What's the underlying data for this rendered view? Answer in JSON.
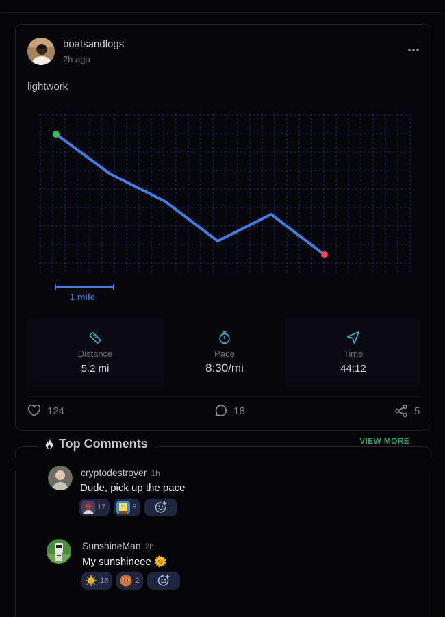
{
  "post": {
    "username": "boatsandlogs",
    "time_ago": "2h ago",
    "caption": "lightwork",
    "scale_label": "1 mile",
    "stats": {
      "distance_label": "Distance",
      "distance_value": "5.2 mi",
      "pace_label": "Pace",
      "pace_value": "8:30/mi",
      "time_label": "Time",
      "time_value": "44:12"
    },
    "likes": "124",
    "comments": "18",
    "shares": "5"
  },
  "top_comments": {
    "title": "Top Comments",
    "view_more": "VIEW MORE",
    "items": [
      {
        "username": "cryptodestroyer",
        "time": "1h",
        "text": "Dude, pick up the pace",
        "reactions": [
          {
            "icon": "person-emoji-icon",
            "count": "17"
          },
          {
            "icon": "cartoon-sponge-emoji-icon",
            "count": "5"
          }
        ]
      },
      {
        "username": "SunshineMan",
        "time": "2h",
        "text": "My sunshineee 🌞",
        "reactions": [
          {
            "icon": "sun-emoji-icon",
            "count": "16"
          },
          {
            "icon": "cookie-face-emoji-icon",
            "count": "2"
          }
        ]
      }
    ]
  },
  "colors": {
    "route_line": "#3f7fe6",
    "start_marker": "#2ec451",
    "end_marker": "#e84c4c",
    "grid_line": "#1c3a8a",
    "stat_icon": "#2bb5d6",
    "accent_green": "#2fa36b",
    "reaction_bg": "#1f2640"
  }
}
